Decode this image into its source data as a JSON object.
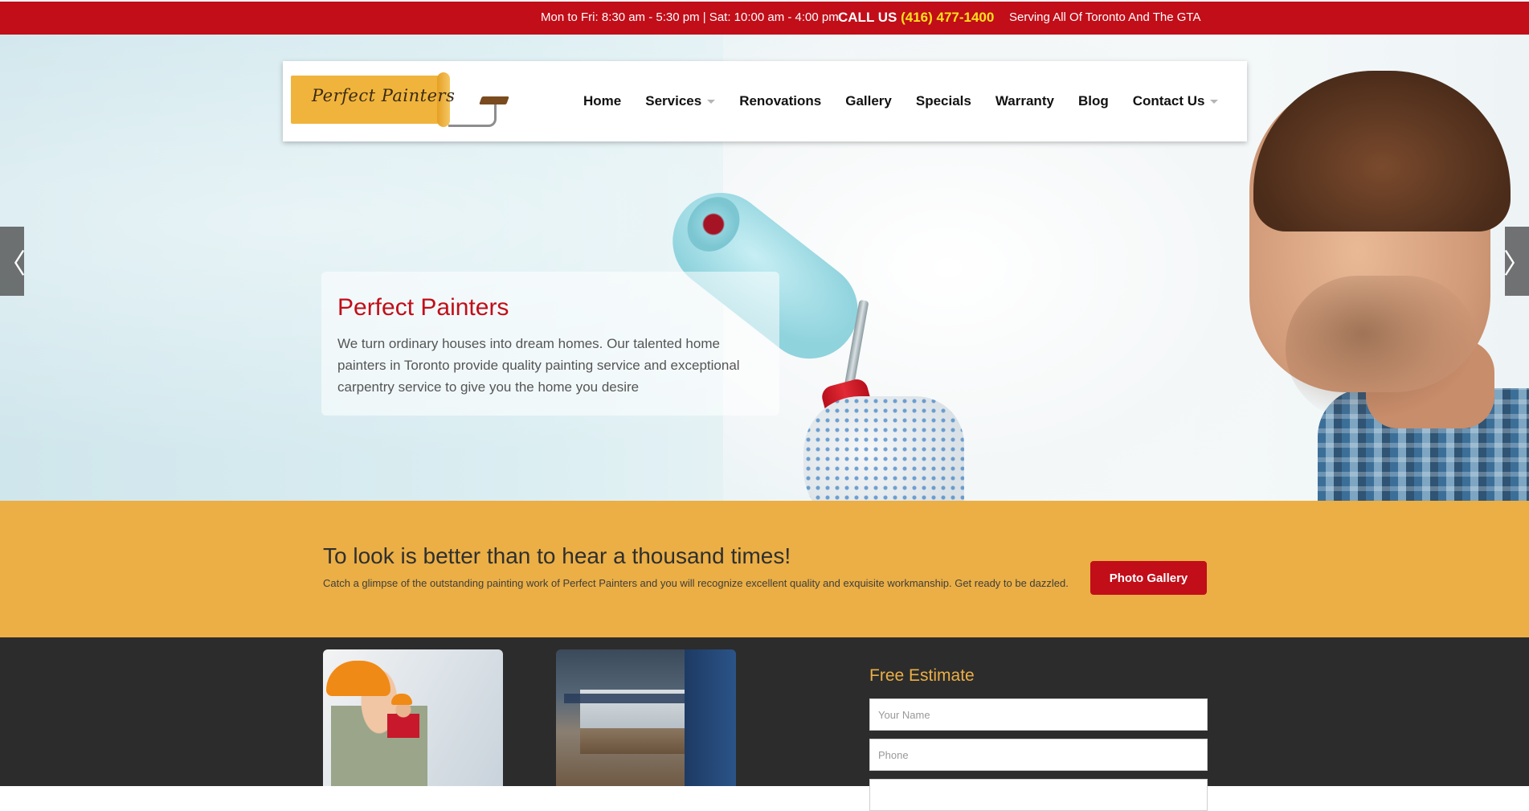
{
  "topbar": {
    "hours": "Mon to Fri: 8:30 am - 5:30 pm | Sat: 10:00 am - 4:00 pm",
    "call_label": "CALL US",
    "phone": "(416) 477-1400",
    "serving": "Serving All Of Toronto And The GTA"
  },
  "logo": {
    "text": "Perfect Painters"
  },
  "nav": {
    "items": [
      {
        "label": "Home",
        "has_dropdown": false
      },
      {
        "label": "Services",
        "has_dropdown": true
      },
      {
        "label": "Renovations",
        "has_dropdown": false
      },
      {
        "label": "Gallery",
        "has_dropdown": false
      },
      {
        "label": "Specials",
        "has_dropdown": false
      },
      {
        "label": "Warranty",
        "has_dropdown": false
      },
      {
        "label": "Blog",
        "has_dropdown": false
      },
      {
        "label": "Contact Us",
        "has_dropdown": true
      }
    ]
  },
  "slider": {
    "prev_glyph": "〈",
    "next_glyph": "〉",
    "caption_title": "Perfect Painters",
    "caption_text": "We turn ordinary houses into dream homes. Our talented home painters in Toronto provide quality painting service and exceptional carpentry service to give you the home you desire"
  },
  "band": {
    "title": "To look is better than to hear a thousand times!",
    "text": "Catch a glimpse of the outstanding painting work of Perfect Painters and you will recognize excellent quality and exquisite workmanship. Get ready to be dazzled.",
    "button": "Photo Gallery"
  },
  "estimate": {
    "title": "Free Estimate",
    "name_placeholder": "Your Name",
    "phone_placeholder": "Phone"
  },
  "colors": {
    "brand_red": "#c10e19",
    "accent_yellow": "#ebaf45",
    "phone_yellow": "#ffe11b",
    "dark_bg": "#2c2c2c"
  }
}
